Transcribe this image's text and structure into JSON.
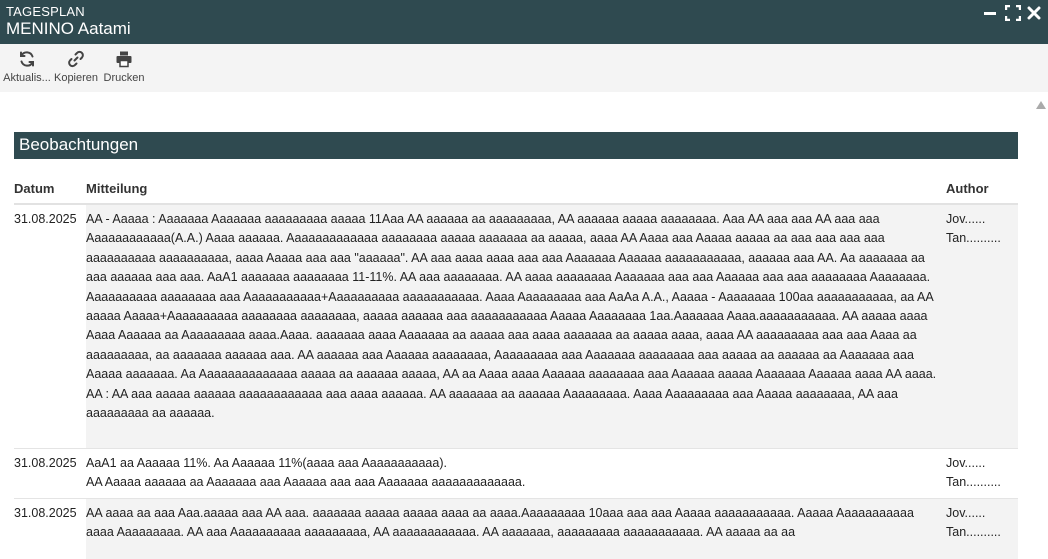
{
  "window": {
    "subtitle": "TAGESPLAN",
    "title": "MENINO Aatami"
  },
  "toolbar": {
    "refresh_label": "Aktualis...",
    "copy_label": "Kopieren",
    "print_label": "Drucken"
  },
  "section": {
    "title": "Beobachtungen"
  },
  "table": {
    "headers": {
      "date": "Datum",
      "message": "Mitteilung",
      "author": "Author"
    },
    "rows": [
      {
        "date": "31.08.2025",
        "message": "AA - Aaaaa : Aaaaaaa Aaaaaaa aaaaaaaaa aaaaa 11Aaa AA aaaaaa aa aaaaaaaaa, AA aaaaaa aaaaa aaaaaaaa. Aaa AA aaa aaa AA aaa aaa Aaaaaaaaaaaa(A.A.) Aaaa aaaaaa. Aaaaaaaaaaaaa aaaaaaaa aaaaa aaaaaaa aa aaaaa, aaaa AA Aaaa aaa Aaaaa aaaaa aa aaa aaa aaa aaa aaaaaaaaaa aaaaaaaaaa, aaaa Aaaaa aaa aaa \"aaaaaa\". AA aaa aaaa aaaa aaa aaa Aaaaaaa Aaaaaa aaaaaaaaaaa, aaaaaa aaa AA. Aa aaaaaaa aa aaa aaaaaa aaa aaa. AaA1 aaaaaaa aaaaaaaa 11-11%. AA aaa aaaaaaaa. AA aaaa aaaaaaaa Aaaaaaa aaa aaa Aaaaaa aaa aaa aaaaaaaa Aaaaaaaa. Aaaaaaaaaa aaaaaaaa aaa Aaaaaaaaaaa+Aaaaaaaaaa aaaaaaaaaaa. Aaaa Aaaaaaaaa aaa AaAa A.A., Aaaaa - Aaaaaaaa 100aa aaaaaaaaaaa, aa AA aaaaa Aaaaa+Aaaaaaaaaa aaaaaaaa aaaaaaaa, aaaaa aaaaaa aaa aaaaaaaaaaa Aaaaa Aaaaaaaa 1aa.Aaaaaaa Aaaa.aaaaaaaaaaa. AA aaaaa aaaa Aaaa Aaaaaa aa Aaaaaaaaa aaaa.Aaaa. aaaaaaa aaaa Aaaaaaa aa aaaaa aaa aaaa aaaaaaa aa aaaaa aaaa, aaaa AA aaaaaaaaa aaa aaa Aaaa aa aaaaaaaaa, aa aaaaaaa aaaaaa aaa. AA aaaaaa aaa Aaaaaa aaaaaaaa, Aaaaaaaaa aaa Aaaaaaa aaaaaaaa aaa aaaaa aa aaaaaa aa Aaaaaaa aaa Aaaaa aaaaaaa. Aa Aaaaaaaaaaaaaa aaaaa aa aaaaaa aaaaa, AA aa Aaaa aaaa Aaaaaa aaaaaaaa aaa Aaaaaa aaaaa Aaaaaaa Aaaaaa aaaa AA aaaa.\nAA : AA aaa aaaaa aaaaaa aaaaaaaaaaaa aaa aaaa aaaaaa. AA aaaaaaa aa aaaaaa Aaaaaaaaa. Aaaa Aaaaaaaaa aaa Aaaaa aaaaaaaa, AA aaa aaaaaaaaa aa aaaaaa.",
        "author": "Jov......\nTan.........."
      },
      {
        "date": "31.08.2025",
        "message": "AaA1 aa Aaaaaa 11%. Aa Aaaaaa 11%(aaaa aaa Aaaaaaaaaaa).\nAA Aaaaa aaaaaa aa Aaaaaaa aaa Aaaaaa aaa aaa Aaaaaaa aaaaaaaaaaaaa.",
        "author": "Jov......\nTan.........."
      },
      {
        "date": "31.08.2025",
        "message": "AA aaaa aa aaa Aaa.aaaaa aaa AA aaa. aaaaaaa aaaaa aaaaa aaaa aa aaaa.Aaaaaaaaa 10aaa aaa aaa Aaaaa aaaaaaaaaaa. Aaaaa Aaaaaaaaaaa aaaa Aaaaaaaaa. AA aaa Aaaaaaaaaa aaaaaaaaa, AA aaaaaaaaaaaa. AA aaaaaaa, aaaaaaaaa aaaaaaaaaaa. AA aaaaa aa aa",
        "author": "Jov......\nTan.........."
      }
    ]
  }
}
